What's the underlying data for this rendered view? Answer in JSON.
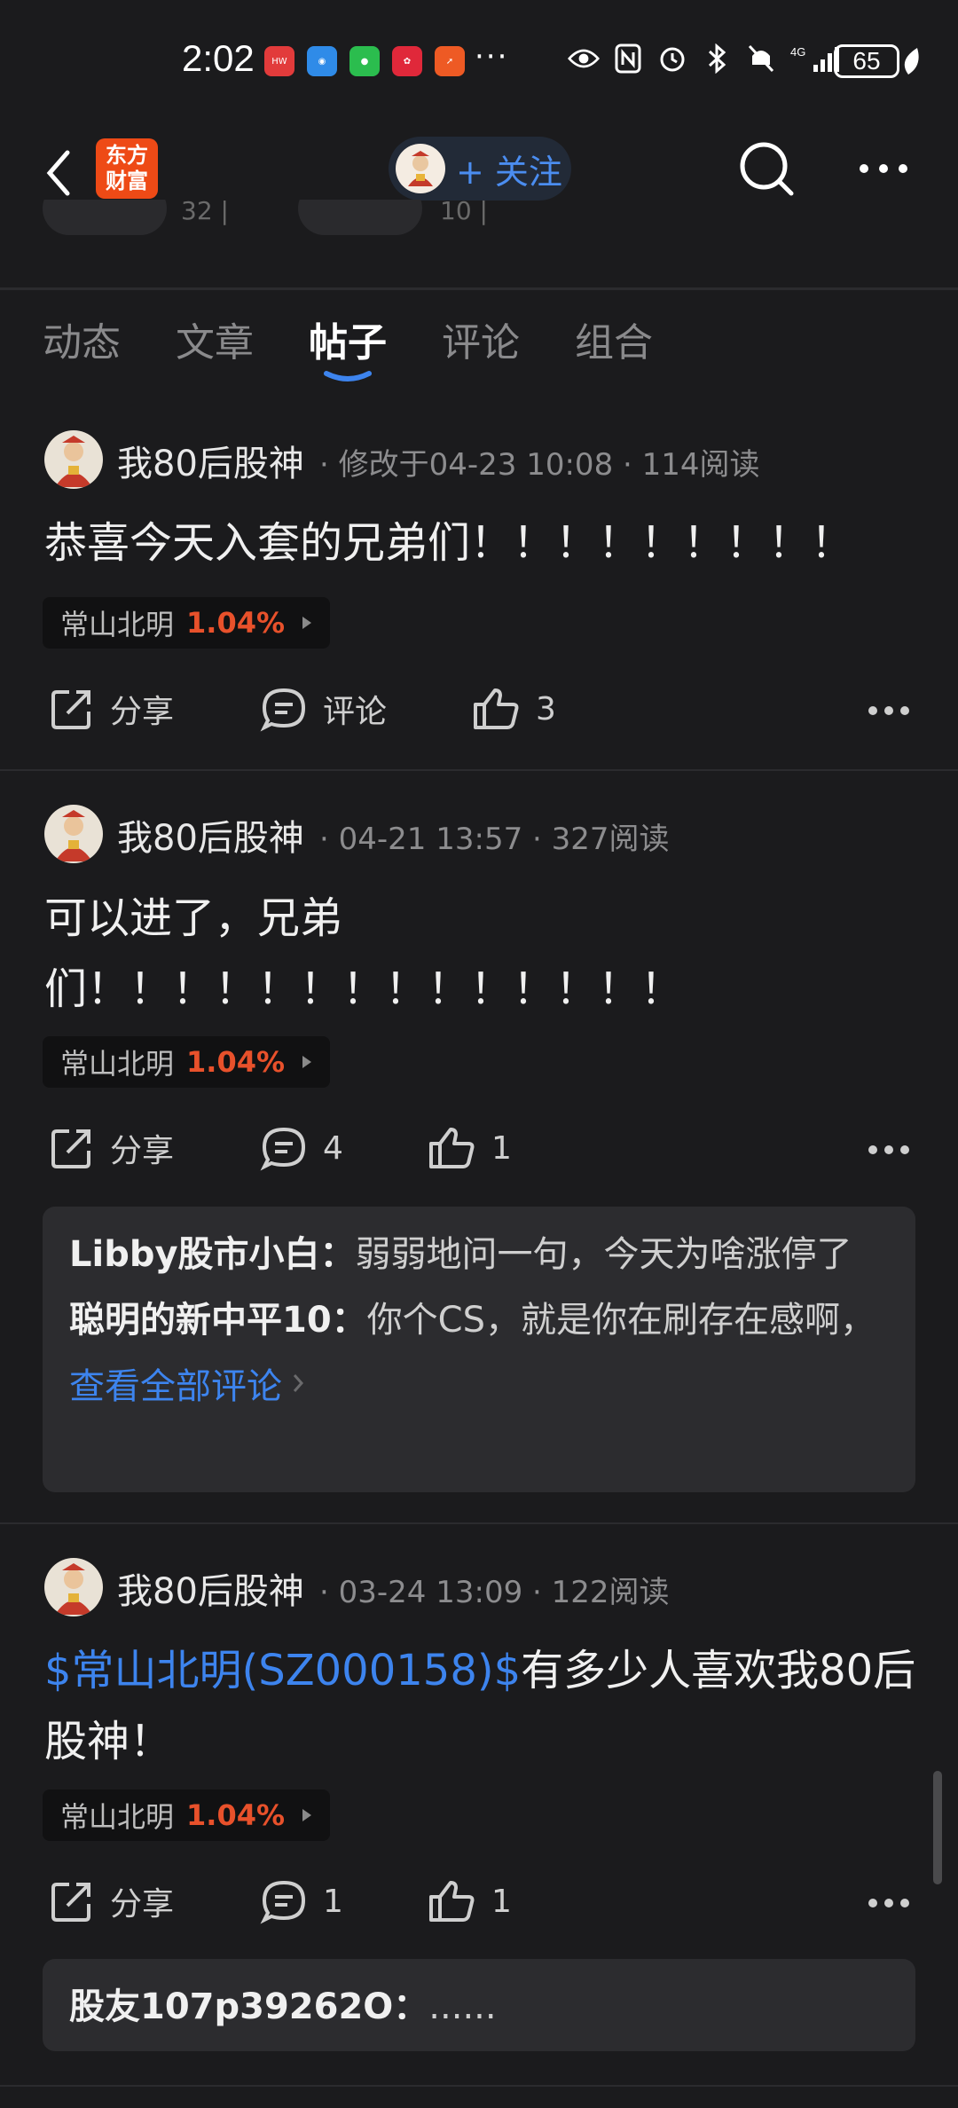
{
  "status": {
    "time": "2:02",
    "more": "···",
    "battery": "65",
    "network": "4G"
  },
  "nav": {
    "logo": "东方\n财富",
    "follow_label": "+ 关注"
  },
  "collapsed": {
    "num1": "32 |",
    "num2": "10 |"
  },
  "tabs": [
    "动态",
    "文章",
    "帖子",
    "评论",
    "组合"
  ],
  "posts": [
    {
      "author": "我80后股神",
      "meta": "· 修改于04-23 10:08 · 114阅读",
      "text": "恭喜今天入套的兄弟们！！！！！！！！！",
      "stock": {
        "name": "常山北明",
        "pct": "1.04%"
      },
      "actions": {
        "share": "分享",
        "comment": "评论",
        "like": "3"
      }
    },
    {
      "author": "我80后股神",
      "meta": "· 04-21 13:57 · 327阅读",
      "text_line1": "可以进了，兄弟",
      "text_line2": "们！！！！！！！！！！！！！！",
      "stock": {
        "name": "常山北明",
        "pct": "1.04%"
      },
      "actions": {
        "share": "分享",
        "comment": "4",
        "like": "1"
      },
      "comments": [
        {
          "author": "Libby股市小白：",
          "text": "弱弱地问一句，今天为啥涨停了"
        },
        {
          "author": "聪明的新中平10：",
          "text": "你个CS，就是你在刷存在感啊，"
        }
      ],
      "view_all": "查看全部评论"
    },
    {
      "author": "我80后股神",
      "meta": "· 03-24 13:09 · 122阅读",
      "text_link": "$常山北明(SZ000158)$",
      "text_rest": "有多少人喜欢我80后股神！",
      "stock": {
        "name": "常山北明",
        "pct": "1.04%"
      },
      "actions": {
        "share": "分享",
        "comment": "1",
        "like": "1"
      },
      "comments": [
        {
          "author": "股友107p39262O：",
          "text": "......"
        }
      ]
    }
  ],
  "colors": {
    "accent": "#3d84ee",
    "up": "#e8512b",
    "logo": "#ee4a16"
  }
}
